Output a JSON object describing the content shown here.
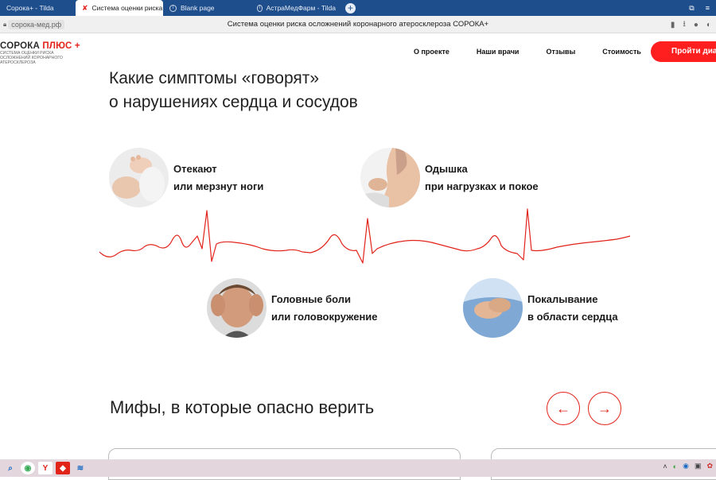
{
  "browser": {
    "tabs": [
      {
        "title": "Сорока+ - Tilda",
        "active": false
      },
      {
        "title": "Система оценки риска",
        "active": true
      },
      {
        "title": "Blank page",
        "active": false
      },
      {
        "title": "АстраМедФарм - Tilda",
        "active": false
      }
    ],
    "new_tab": "+",
    "domain": "сорока-мед.рф",
    "page_title": "Система оценки риска осложнений коронарного атеросклероза СОРОКА+"
  },
  "site": {
    "logo_title_main": "СОРОКА",
    "logo_title_accent": "ПЛЮС +",
    "logo_subtitle": "СИСТЕМА ОЦЕНКИ РИСКА ОСЛОЖНЕНИЙ КОРОНАРНОГО АТЕРОСКЛЕРОЗА",
    "nav": [
      "О проекте",
      "Наши врачи",
      "Отзывы",
      "Стоимость"
    ],
    "cta_label": "Пройти диагностику",
    "accent_color": "#e2231a"
  },
  "symptoms_section": {
    "title_line1": "Какие симптомы «говорят»",
    "title_line2": "о нарушениях сердца и сосудов",
    "items": [
      {
        "line1": "Отекают",
        "line2": "или мерзнут ноги",
        "image": "feet-photo"
      },
      {
        "line1": "Одышка",
        "line2": "при нагрузках и покое",
        "image": "neck-photo"
      },
      {
        "line1": "Головные боли",
        "line2": "или головокружение",
        "image": "headache-photo"
      },
      {
        "line1": "Покалывание",
        "line2": "в области сердца",
        "image": "chest-photo"
      }
    ]
  },
  "myths_section": {
    "title": "Мифы, в которые опасно верить",
    "prev_icon": "arrow-left-icon",
    "next_icon": "arrow-right-icon"
  }
}
